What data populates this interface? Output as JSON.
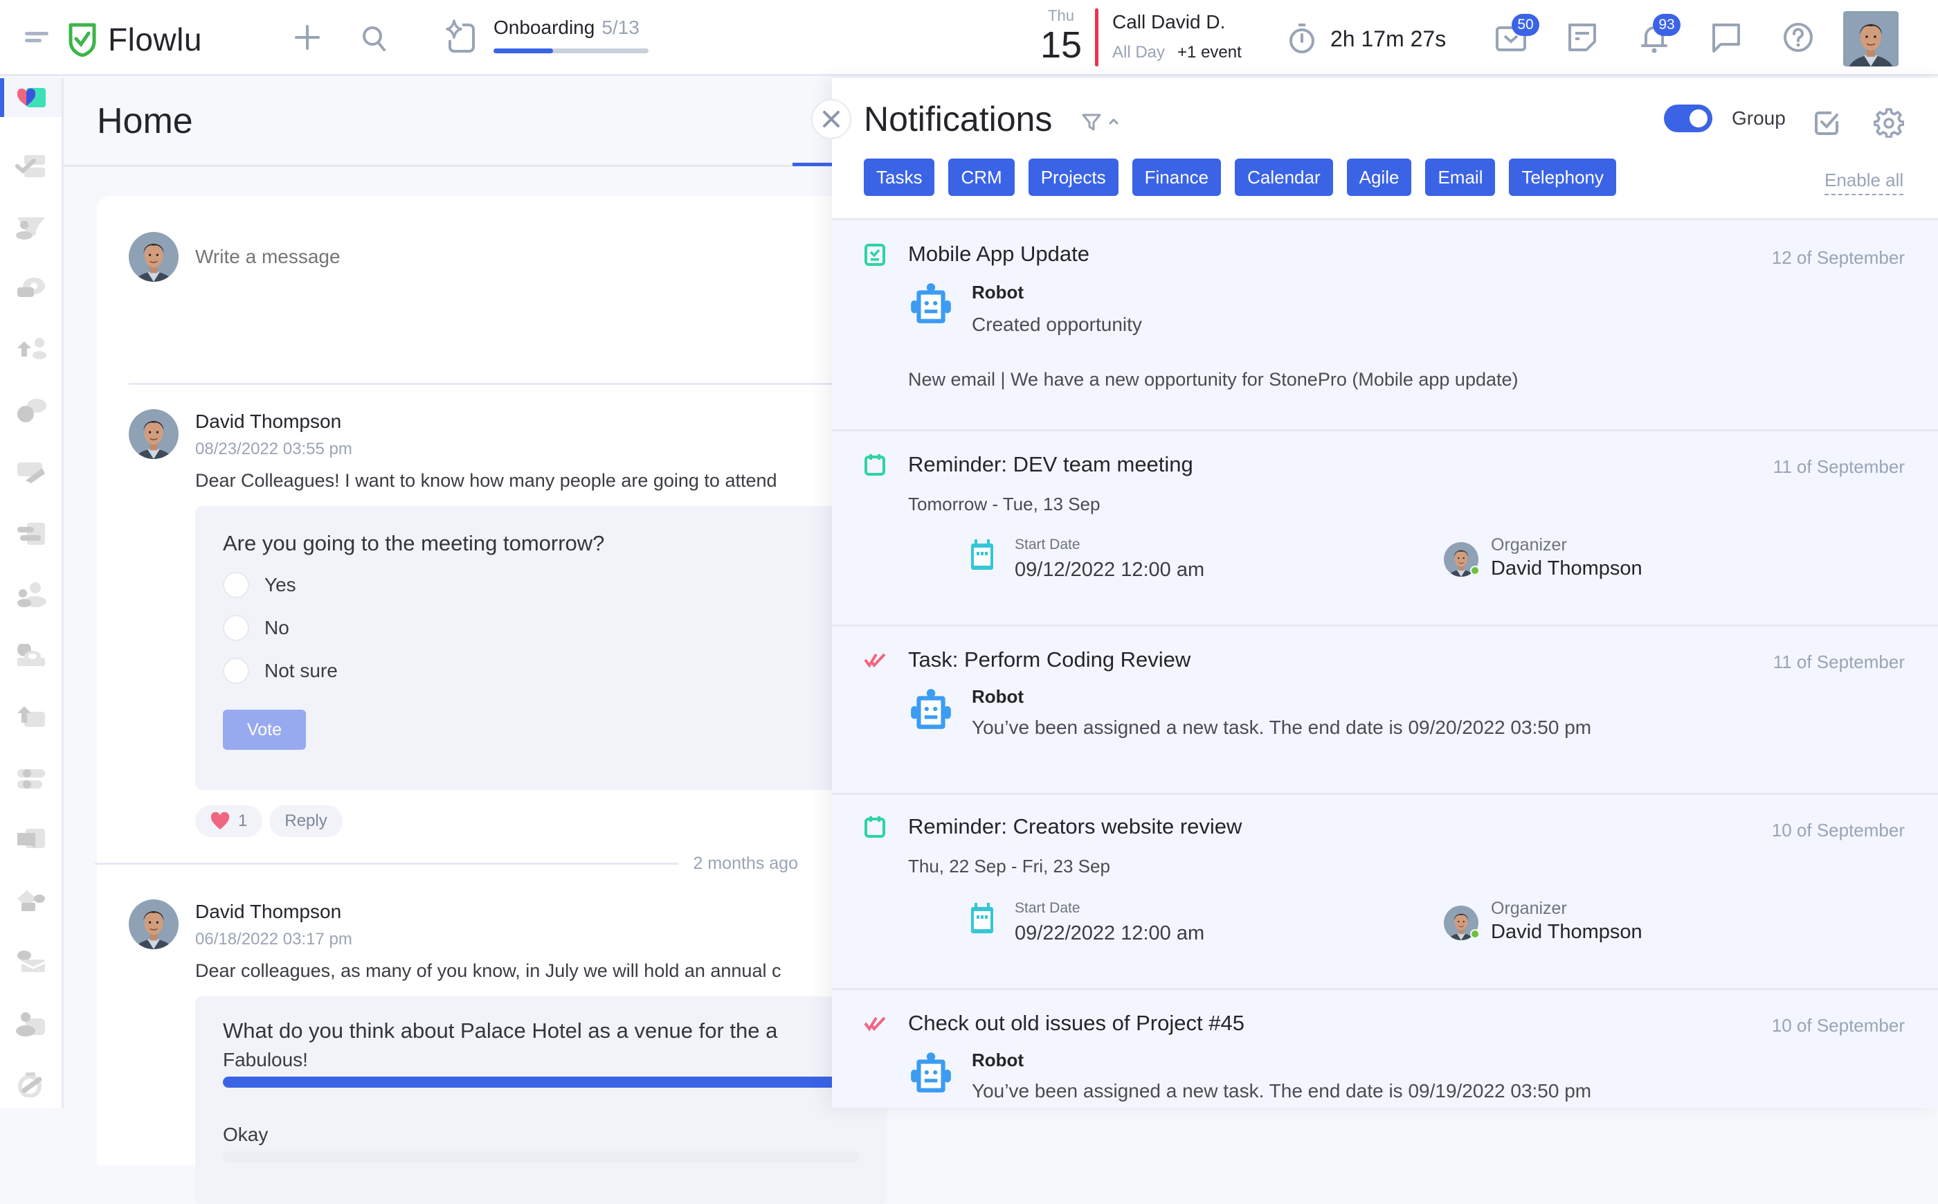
{
  "app": {
    "name": "Flowlu"
  },
  "topbar": {
    "onboarding": {
      "label": "Onboarding",
      "count": "5/13",
      "progress": 0.385
    },
    "calendar": {
      "dow": "Thu",
      "day": "15",
      "event_title": "Call David D.",
      "event_time": "All Day",
      "more_events": "+1 event"
    },
    "timer": "2h 17m 27s",
    "mail_badge": "50",
    "bell_badge": "93",
    "icons": [
      "menu-icon",
      "add-icon",
      "search-icon",
      "onboarding-icon",
      "stopwatch-icon",
      "mail-icon",
      "notes-icon",
      "bell-icon",
      "chat-icon",
      "help-icon",
      "user-avatar"
    ]
  },
  "sidebar": {
    "items": [
      {
        "name": "home",
        "active": true
      },
      {
        "name": "tasks"
      },
      {
        "name": "crm"
      },
      {
        "name": "conversations"
      },
      {
        "name": "projects"
      },
      {
        "name": "finance"
      },
      {
        "name": "knowledge-base"
      },
      {
        "name": "agile"
      },
      {
        "name": "team"
      },
      {
        "name": "calendar"
      },
      {
        "name": "docs"
      },
      {
        "name": "toggles"
      },
      {
        "name": "messages"
      },
      {
        "name": "marketplace"
      },
      {
        "name": "email"
      },
      {
        "name": "contacts"
      },
      {
        "name": "settings"
      }
    ]
  },
  "main": {
    "title": "Home",
    "composer": {
      "placeholder": "Write a message"
    },
    "posts": [
      {
        "author": "David Thompson",
        "date": "08/23/2022 03:55 pm",
        "text": "Dear Colleagues! I want to know how many people are going to attend",
        "poll": {
          "question": "Are you going to the meeting tomorrow?",
          "options": [
            "Yes",
            "No",
            "Not sure"
          ],
          "vote_label": "Vote"
        },
        "likes": "1",
        "reply_label": "Reply"
      },
      {
        "author": "David Thompson",
        "date": "06/18/2022 03:17 pm",
        "text": "Dear colleagues, as many of you know, in July we will hold an annual c",
        "poll": {
          "question": "What do you think about Palace Hotel as a venue for the a",
          "results": [
            {
              "label": "Fabulous!",
              "share": 1.0
            },
            {
              "label": "Okay",
              "share": 0.0
            }
          ]
        }
      }
    ],
    "separator": "2 months ago"
  },
  "notifications": {
    "title": "Notifications",
    "group_label": "Group",
    "group_on": true,
    "enable_all": "Enable all",
    "filters": [
      "Tasks",
      "CRM",
      "Projects",
      "Finance",
      "Calendar",
      "Agile",
      "Email",
      "Telephony"
    ],
    "items": [
      {
        "kind": "crm",
        "title": "Mobile App Update",
        "date": "12 of September",
        "actor": "Robot",
        "body": "Created opportunity",
        "extra": "New email | We have a new opportunity for StonePro (Mobile app update)"
      },
      {
        "kind": "reminder",
        "title": "Reminder: DEV team meeting",
        "date": "11 of September",
        "subtitle": "Tomorrow - Tue, 13 Sep",
        "start_label": "Start Date",
        "start_value": "09/12/2022 12:00 am",
        "organizer_label": "Organizer",
        "organizer": "David Thompson"
      },
      {
        "kind": "task",
        "title": "Task: Perform Coding Review",
        "date": "11 of September",
        "actor": "Robot",
        "body": "You’ve been assigned a new task. The end date is 09/20/2022 03:50 pm"
      },
      {
        "kind": "reminder",
        "title": "Reminder: Creators website review",
        "date": "10 of September",
        "subtitle": "Thu, 22 Sep - Fri, 23 Sep",
        "start_label": "Start Date",
        "start_value": "09/22/2022 12:00 am",
        "organizer_label": "Organizer",
        "organizer": "David Thompson"
      },
      {
        "kind": "task",
        "title": "Check out old issues of Project #45",
        "date": "10 of September",
        "actor": "Robot",
        "body": "You’ve been assigned a new task. The end date is 09/19/2022 03:50 pm"
      }
    ]
  },
  "colors": {
    "accent": "#3a63e6",
    "brand_green": "#3cb54a",
    "danger": "#e8344e",
    "teal": "#2ed3a6",
    "cyan": "#34c6d6",
    "robot": "#3b9cf2",
    "muted": "#99a4b6"
  }
}
